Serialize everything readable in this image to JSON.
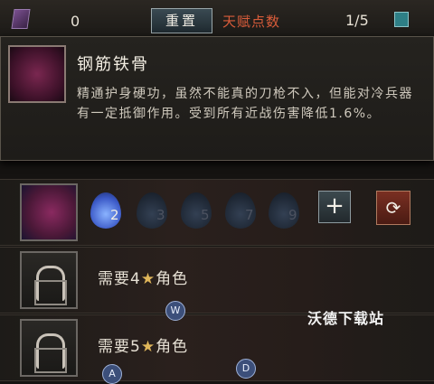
{
  "topbar": {
    "gem_count": "0",
    "reset_label": "重置",
    "points_label": "天赋点数",
    "points_value": "1/5"
  },
  "tooltip": {
    "title": "钢筋铁骨",
    "description": "精通护身硬功，虽然不能真的刀枪不入，但能对冷兵器有一定抵御作用。受到所有近战伤害降低1.6%。"
  },
  "talent_row": {
    "levels": [
      {
        "label": "2",
        "unlocked": true
      },
      {
        "label": "3",
        "unlocked": false
      },
      {
        "label": "5",
        "unlocked": false
      },
      {
        "label": "7",
        "unlocked": false
      },
      {
        "label": "9",
        "unlocked": false
      }
    ],
    "add_label": "+",
    "swap_label": "⟳"
  },
  "locked_rows": [
    {
      "prefix": "需要4",
      "star": "★",
      "suffix": "角色"
    },
    {
      "prefix": "需要5",
      "star": "★",
      "suffix": "角色"
    }
  ],
  "key_badges": {
    "w": "W",
    "a": "A",
    "d": "D"
  },
  "watermark": "沃德下载站",
  "icons": [
    "gem-icon",
    "book-icon",
    "talent-icon",
    "lock-icon",
    "flame-icon",
    "plus-icon",
    "swap-icon",
    "star-icon"
  ]
}
